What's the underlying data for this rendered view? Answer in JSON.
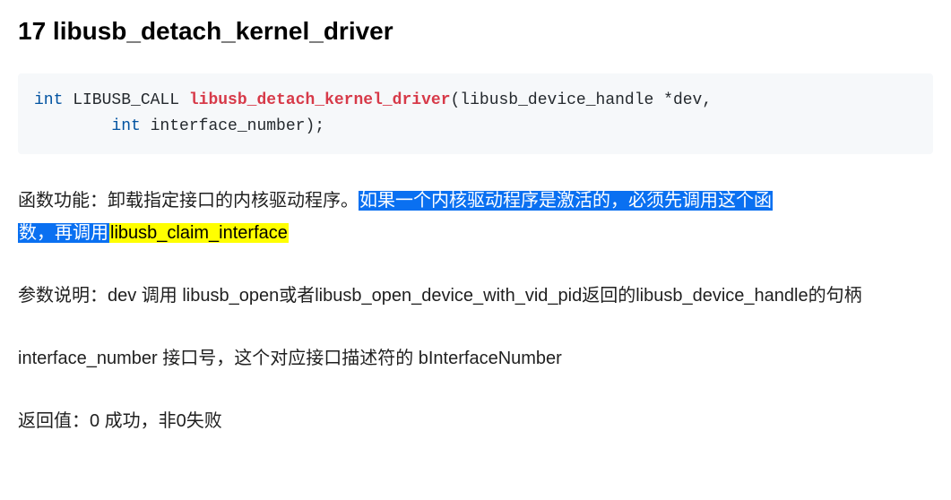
{
  "heading": "17 libusb_detach_kernel_driver",
  "code": {
    "kw_int1": "int",
    "call_macro": " LIBUSB_CALL ",
    "fn_name": "libusb_detach_kernel_driver",
    "sig_tail1": "(libusb_device_handle *dev,",
    "indent": "        ",
    "kw_int2": "int",
    "sig_tail2": " interface_number);"
  },
  "desc": {
    "prefix": "函数功能：卸载指定接口的内核驱动程序。",
    "blue1": "如果一个内核驱动程序是激活的，必须先调用这个函",
    "blue2": "数，再调用",
    "yellow": "libusb_claim_interface"
  },
  "params1": "参数说明：dev 调用 libusb_open或者libusb_open_device_with_vid_pid返回的libusb_device_handle的句柄",
  "params2": "interface_number 接口号，这个对应接口描述符的 bInterfaceNumber",
  "retval": "返回值：0 成功，非0失败"
}
